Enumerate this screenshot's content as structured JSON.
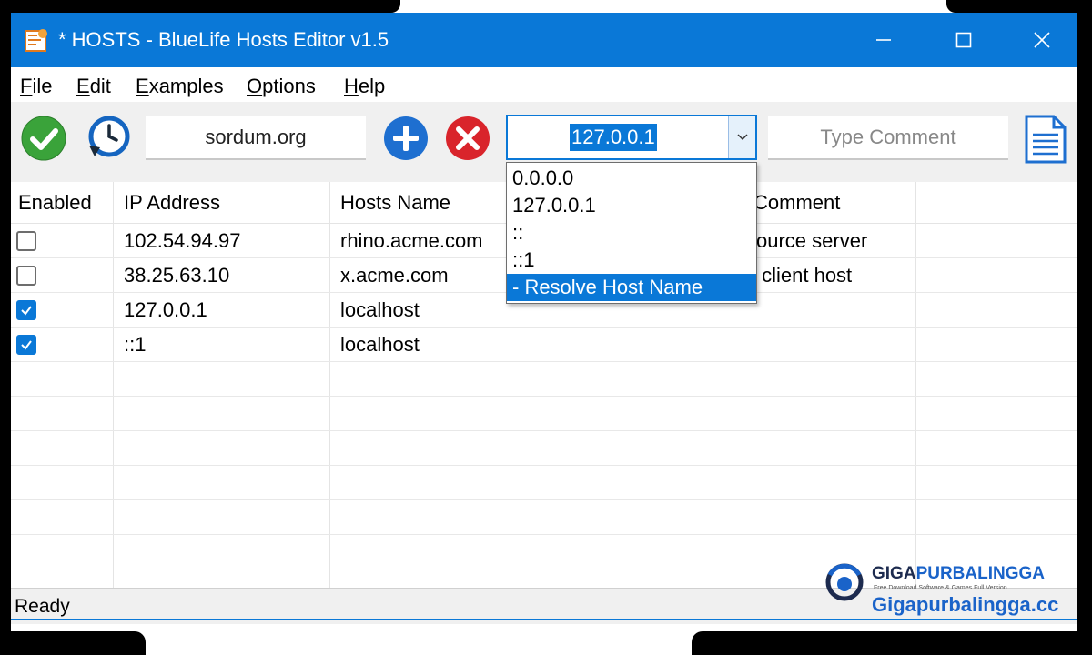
{
  "window": {
    "title": "* HOSTS - BlueLife Hosts Editor v1.5",
    "minimize": "—",
    "maximize": "☐",
    "close": "✕"
  },
  "menu": [
    {
      "label": "File",
      "mnemonic": "F",
      "rest": "ile"
    },
    {
      "label": "Edit",
      "mnemonic": "E",
      "rest": "dit"
    },
    {
      "label": "Examples",
      "mnemonic": "E",
      "rest": "xamples"
    },
    {
      "label": "Options",
      "mnemonic": "O",
      "rest": "ptions"
    },
    {
      "label": "Help",
      "mnemonic": "H",
      "rest": "elp"
    }
  ],
  "toolbar": {
    "host_value": "sordum.org",
    "ip_selected": "127.0.0.1",
    "comment_placeholder": "Type Comment"
  },
  "ip_dropdown": {
    "options": [
      "0.0.0.0",
      "127.0.0.1",
      "::",
      "::1",
      "- Resolve Host Name"
    ],
    "highlighted_index": 4
  },
  "table": {
    "columns": [
      "Enabled",
      "IP Address",
      "Hosts Name",
      "Comment"
    ],
    "rows": [
      {
        "enabled": false,
        "ip": "102.54.94.97",
        "host": "rhino.acme.com",
        "comment": "source server"
      },
      {
        "enabled": false,
        "ip": "38.25.63.10",
        "host": "x.acme.com",
        "comment": "x client host"
      },
      {
        "enabled": true,
        "ip": "127.0.0.1",
        "host": "localhost",
        "comment": ""
      },
      {
        "enabled": true,
        "ip": "::1",
        "host": "localhost",
        "comment": ""
      }
    ]
  },
  "status": {
    "text": "Ready"
  },
  "watermark": {
    "brand_a": "GIGA",
    "brand_b": "PURBALINGGA",
    "tagline": "Free Download Software & Games Full Version",
    "url": "Gigapurbalingga.cc"
  },
  "colors": {
    "titlebar": "#0a78d7",
    "toolbar": "#f0f0f0",
    "selection": "#0a78d7"
  }
}
